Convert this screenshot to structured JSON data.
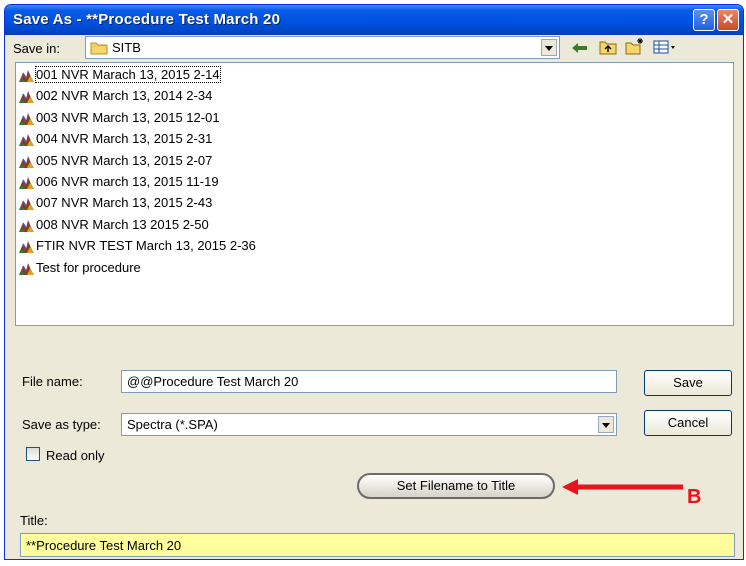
{
  "window": {
    "title": "Save As - **Procedure Test March 20",
    "help_glyph": "?",
    "close_glyph": "✕"
  },
  "toolbar": {
    "save_in_label": "Save in:",
    "save_in_value": "SITB",
    "icons": [
      "back-arrow-icon",
      "up-folder-icon",
      "new-folder-icon",
      "view-menu-icon"
    ]
  },
  "files": [
    "001 NVR Marach 13, 2015 2-14",
    "002 NVR March 13, 2014 2-34",
    "003 NVR March 13, 2015 12-01",
    "004 NVR March 13, 2015 2-31",
    "005 NVR March 13, 2015 2-07",
    "006 NVR march 13, 2015 11-19",
    "007 NVR March 13, 2015 2-43",
    "008 NVR March 13 2015 2-50",
    "FTIR NVR TEST March 13, 2015 2-36",
    "Test for procedure"
  ],
  "form": {
    "file_name_label": "File name:",
    "file_name_value": "@@Procedure Test March 20",
    "save_type_label": "Save as type:",
    "save_type_value": "Spectra (*.SPA)",
    "read_only_label": "Read only",
    "read_only_checked": false,
    "save_button": "Save",
    "cancel_button": "Cancel",
    "set_filename_button": "Set Filename to Title",
    "title_label": "Title:",
    "title_value": "**Procedure Test March 20"
  },
  "annotation": {
    "label": "B",
    "color": "#e8141c"
  },
  "colors": {
    "titlebar": "#0054e3",
    "dialog_bg": "#ece9d8",
    "title_field_bg": "#fefe9c"
  }
}
